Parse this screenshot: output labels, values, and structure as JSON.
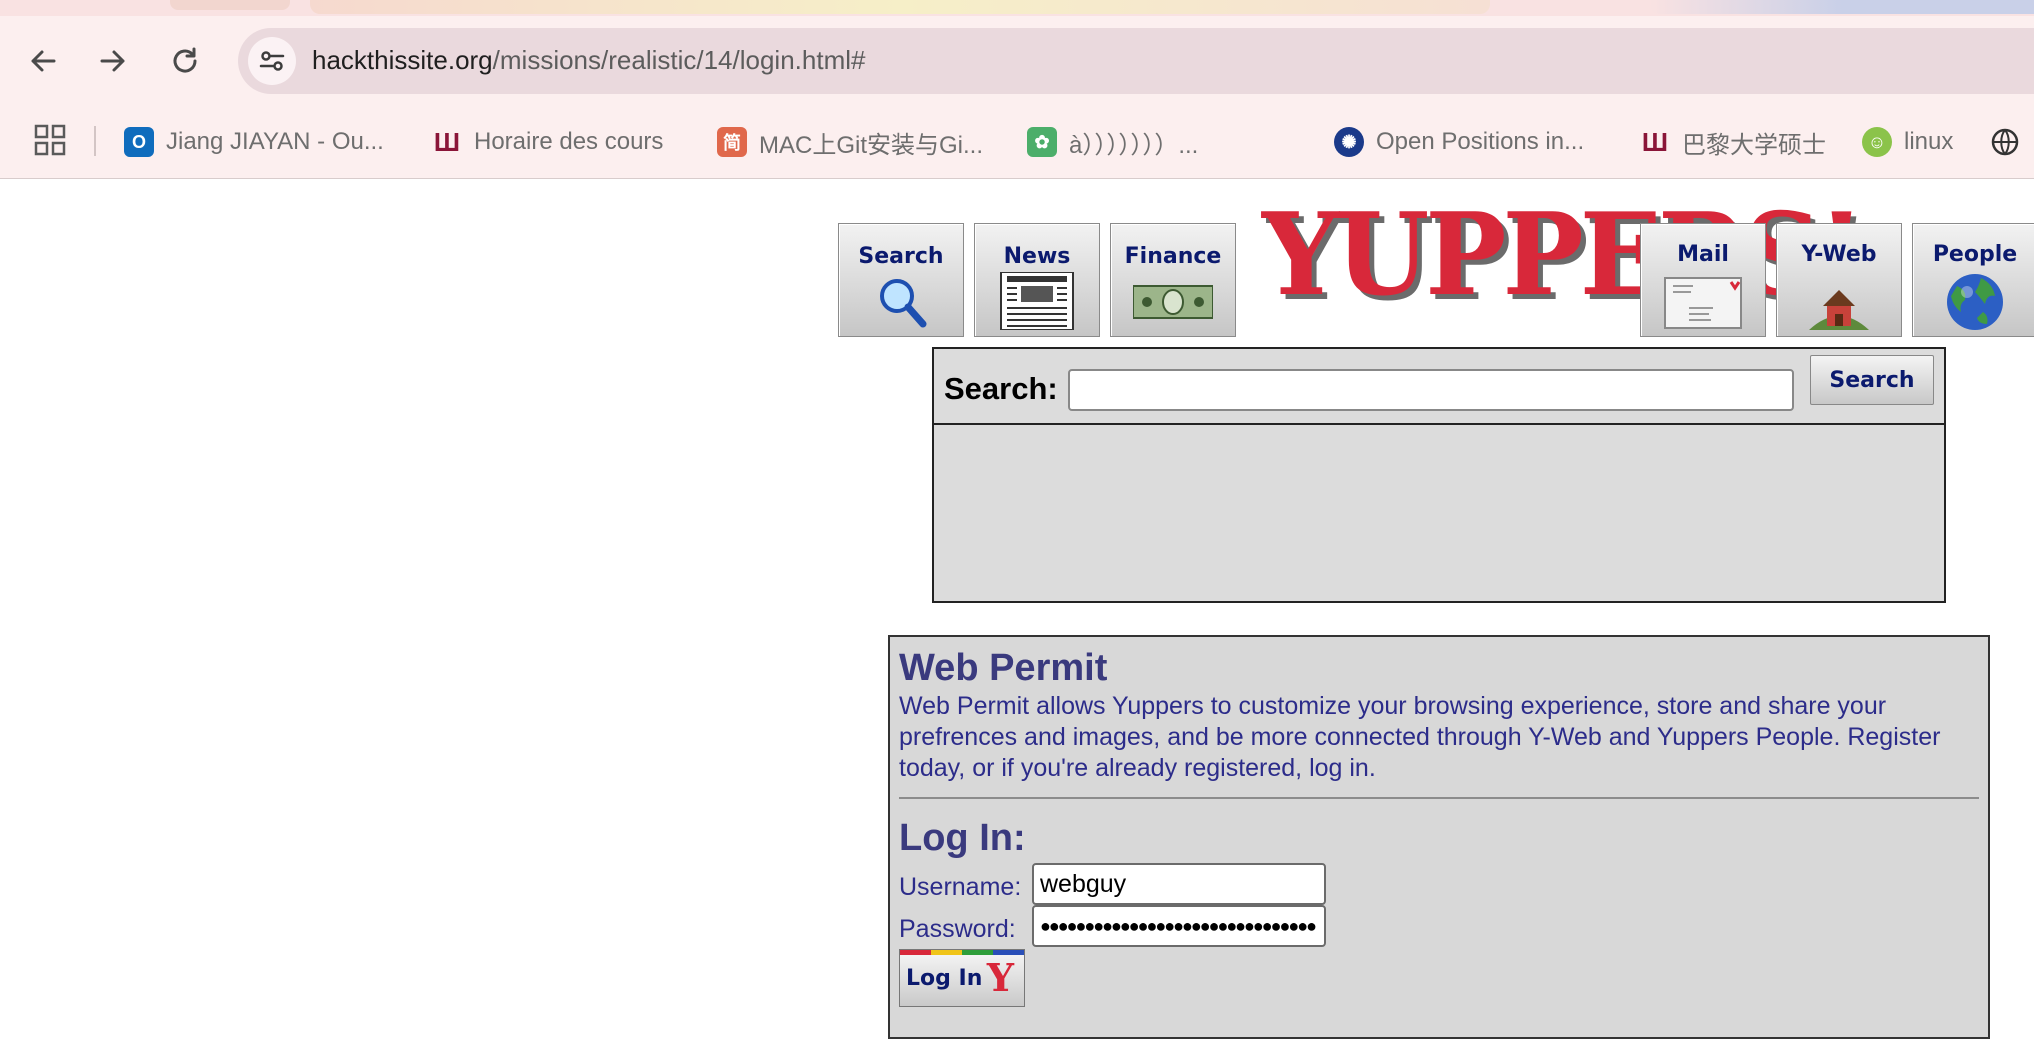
{
  "browser": {
    "url_domain": "hackthissite.org",
    "url_path": "/missions/realistic/14/login.html#",
    "bookmarks": [
      {
        "label": "Jiang JIAYAN - Ou...",
        "icon": "outlook-icon"
      },
      {
        "label": "Horaire des cours",
        "icon": "university-icon"
      },
      {
        "label": "MAC上Git安装与Gi...",
        "icon": "jianshu-icon"
      },
      {
        "label": "à）））））））...",
        "icon": "paw-icon"
      },
      {
        "label": "Open Positions in...",
        "icon": "globe-seal-icon"
      },
      {
        "label": "巴黎大学硕士",
        "icon": "university-icon"
      },
      {
        "label": "linux",
        "icon": "face-icon"
      }
    ]
  },
  "site": {
    "logo": "YUPPERS!",
    "nav": {
      "search": "Search",
      "news": "News",
      "finance": "Finance",
      "mail": "Mail",
      "yweb": "Y-Web",
      "people": "People"
    },
    "search": {
      "label": "Search:",
      "value": "",
      "button": "Search"
    },
    "permit": {
      "title": "Web Permit",
      "description": "Web Permit allows Yuppers to customize your browsing experience, store and share your prefrences and images, and be more connected through Y-Web and Yuppers People. Register today, or if you're already registered, log in."
    },
    "login": {
      "title": "Log In:",
      "username_label": "Username:",
      "username_value": "webguy",
      "password_label": "Password:",
      "password_value": "●●●●●●●●●●●●●●●●●●●●●●●●●●●●●●●",
      "button": "Log In"
    }
  }
}
